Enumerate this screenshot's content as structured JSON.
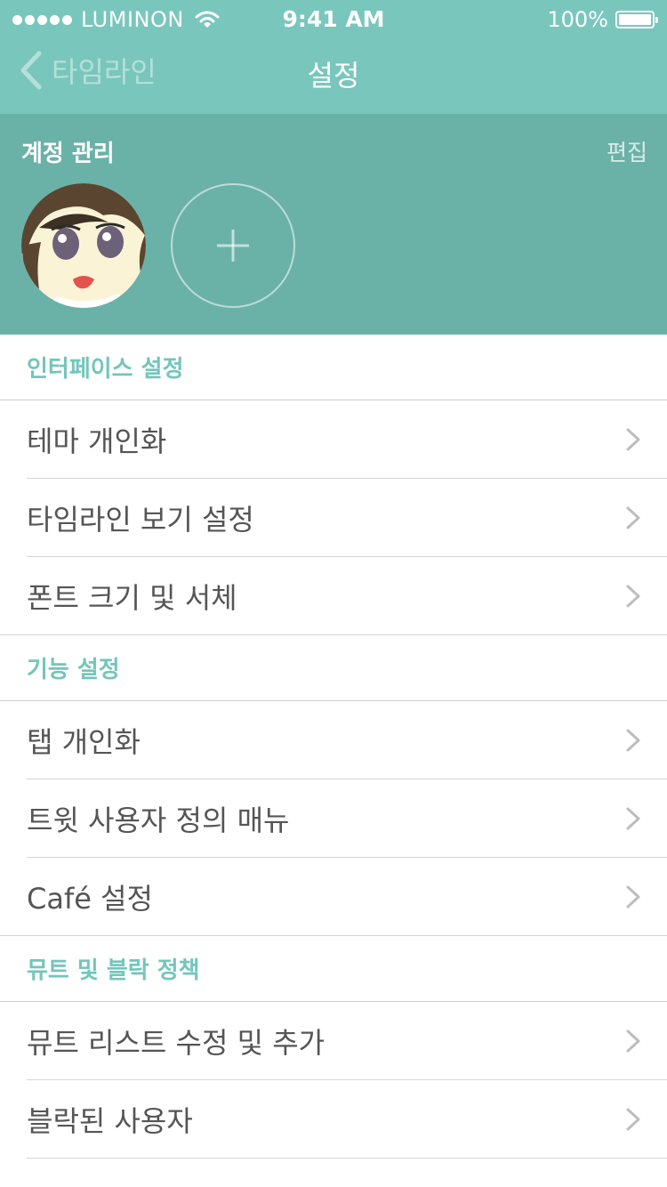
{
  "status_bar": {
    "carrier": "LUMINON",
    "time": "9:41 AM",
    "battery": "100%"
  },
  "nav": {
    "back_label": "타임라인",
    "title": "설정"
  },
  "account": {
    "title": "계정 관리",
    "edit_label": "편집"
  },
  "sections": [
    {
      "header": "인터페이스 설정",
      "items": [
        "테마 개인화",
        "타임라인 보기 설정",
        "폰트 크기 및 서체"
      ]
    },
    {
      "header": "기능 설정",
      "items": [
        "탭 개인화",
        "트윗 사용자 정의 매뉴",
        "Café 설정"
      ]
    },
    {
      "header": "뮤트 및 블락 정책",
      "items": [
        "뮤트 리스트 수정 및 추가",
        "블락된 사용자"
      ]
    }
  ],
  "colors": {
    "header_bg": "#79c6bc",
    "account_bg": "#6ab2a8",
    "accent": "#74c5bb"
  }
}
